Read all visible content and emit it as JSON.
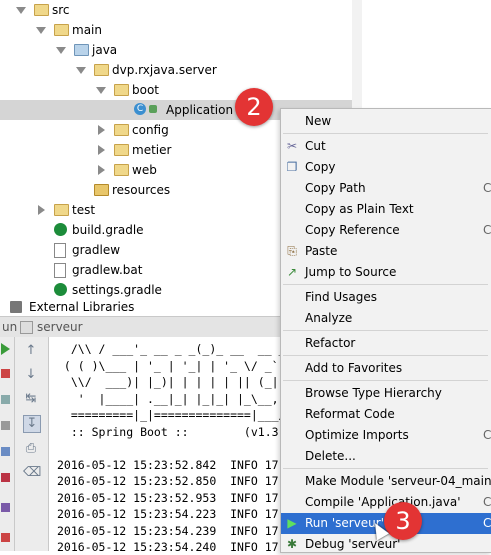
{
  "tree": [
    {
      "label": "src",
      "icon": "folder-icon",
      "arrow": "down",
      "indent": 0
    },
    {
      "label": "main",
      "icon": "folder-icon",
      "arrow": "down",
      "indent": 1
    },
    {
      "label": "java",
      "icon": "source-folder-icon",
      "arrow": "down",
      "indent": 2
    },
    {
      "label": "dvp.rxjava.server",
      "icon": "package-icon",
      "arrow": "down",
      "indent": 3
    },
    {
      "label": "boot",
      "icon": "package-icon",
      "arrow": "down",
      "indent": 4
    },
    {
      "label": "Application",
      "icon": "class-icon",
      "arrow": "none",
      "indent": 5,
      "selected": true
    },
    {
      "label": "config",
      "icon": "package-icon",
      "arrow": "right",
      "indent": 4
    },
    {
      "label": "metier",
      "icon": "package-icon",
      "arrow": "right",
      "indent": 4
    },
    {
      "label": "web",
      "icon": "package-icon",
      "arrow": "right",
      "indent": 4
    },
    {
      "label": "resources",
      "icon": "resources-folder-icon",
      "arrow": "none",
      "indent": 3
    },
    {
      "label": "test",
      "icon": "folder-icon",
      "arrow": "right",
      "indent": 1
    },
    {
      "label": "build.gradle",
      "icon": "gradle-icon",
      "arrow": "none",
      "indent": 1
    },
    {
      "label": "gradlew",
      "icon": "file-icon",
      "arrow": "none",
      "indent": 1
    },
    {
      "label": "gradlew.bat",
      "icon": "file-icon",
      "arrow": "none",
      "indent": 1
    },
    {
      "label": "settings.gradle",
      "icon": "gradle-icon",
      "arrow": "none",
      "indent": 1
    }
  ],
  "external_libraries": "External Libraries",
  "run_tab": {
    "prefix": "un",
    "name": "serveur"
  },
  "console_lines": [
    "  /\\\\ / ___'_ __ _ _(_)_ __  __ _",
    " ( ( )\\___ | '_ | '_| | '_ \\/ _`",
    "  \\\\/  ___)| |_)| | | | | || (_|",
    "   '  |____| .__|_| |_|_| |_\\__,",
    "  =========|_|==============|___/",
    "  :: Spring Boot ::        (v1.3.",
    "",
    "2016-05-12 15:23:52.842  INFO 17",
    "2016-05-12 15:23:52.850  INFO 17",
    "2016-05-12 15:23:52.953  INFO 17",
    "2016-05-12 15:23:54.223  INFO 17",
    "2016-05-12 15:23:54.239  INFO 17",
    "2016-05-12 15:23:54.240  INFO 17"
  ],
  "context_menu": [
    {
      "label": "New",
      "icon": "",
      "shortcut": "",
      "sep_after": true
    },
    {
      "label": "Cut",
      "icon": "scissors-icon",
      "shortcut": ""
    },
    {
      "label": "Copy",
      "icon": "copy-icon",
      "shortcut": ""
    },
    {
      "label": "Copy Path",
      "icon": "",
      "shortcut": "C"
    },
    {
      "label": "Copy as Plain Text",
      "icon": "",
      "shortcut": ""
    },
    {
      "label": "Copy Reference",
      "icon": "",
      "shortcut": "Ctrl+A"
    },
    {
      "label": "Paste",
      "icon": "paste-icon",
      "shortcut": ""
    },
    {
      "label": "Jump to Source",
      "icon": "jump-icon",
      "shortcut": "",
      "sep_after": true
    },
    {
      "label": "Find Usages",
      "icon": "",
      "shortcut": ""
    },
    {
      "label": "Analyze",
      "icon": "",
      "shortcut": "",
      "sep_after": true
    },
    {
      "label": "Refactor",
      "icon": "",
      "shortcut": "",
      "sep_after": true
    },
    {
      "label": "Add to Favorites",
      "icon": "",
      "shortcut": "",
      "sep_after": true
    },
    {
      "label": "Browse Type Hierarchy",
      "icon": "",
      "shortcut": ""
    },
    {
      "label": "Reformat Code",
      "icon": "",
      "shortcut": ""
    },
    {
      "label": "Optimize Imports",
      "icon": "",
      "shortcut": "C"
    },
    {
      "label": "Delete...",
      "icon": "",
      "shortcut": "",
      "sep_after": true
    },
    {
      "label": "Make Module 'serveur-04_main'",
      "icon": "",
      "shortcut": ""
    },
    {
      "label": "Compile 'Application.java'",
      "icon": "",
      "shortcut": "Ct"
    },
    {
      "label": "Run 'serveur'",
      "icon": "run-icon",
      "shortcut": "Ctrl",
      "highlighted": true
    },
    {
      "label": "Debug 'serveur'",
      "icon": "debug-icon",
      "shortcut": ""
    }
  ],
  "badges": [
    "2",
    "3"
  ],
  "colors": {
    "highlight": "#2e6fd0",
    "badge": "#e33434",
    "selection": "#d5d5d5"
  }
}
